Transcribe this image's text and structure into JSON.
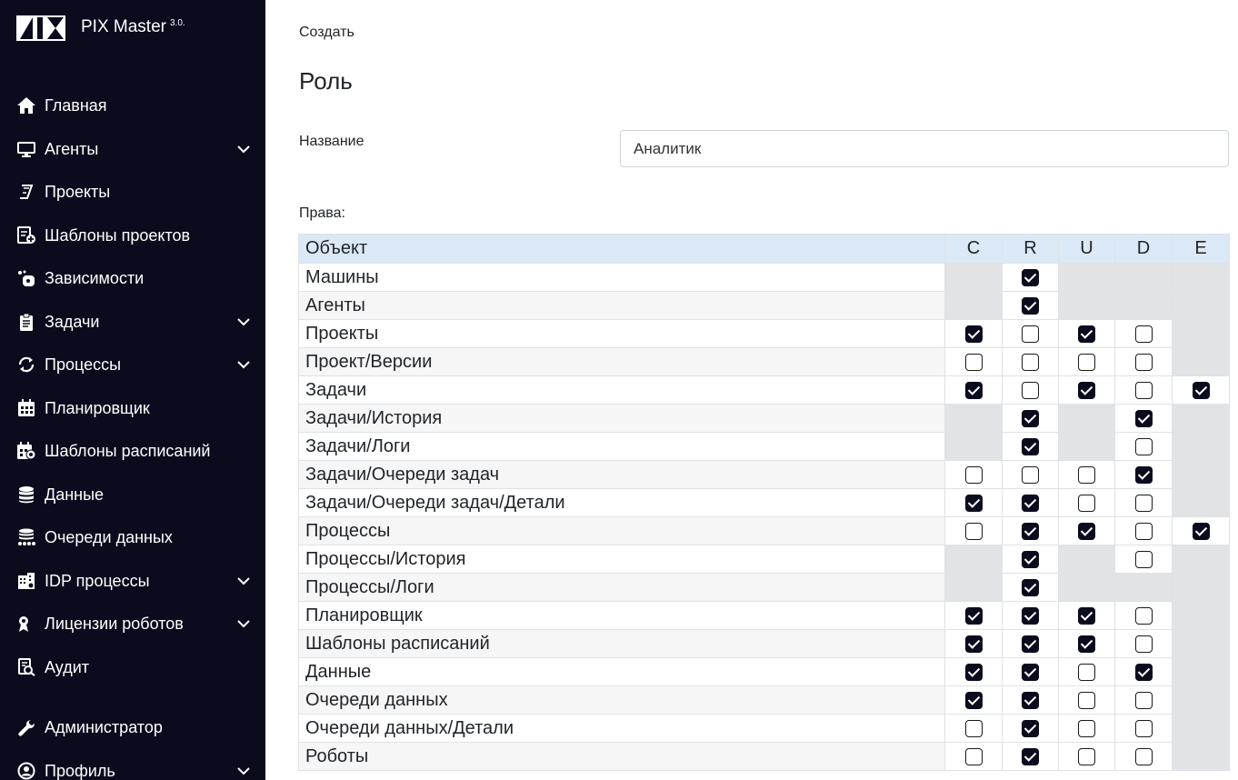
{
  "app": {
    "name": "PIX Master",
    "version": "3.0."
  },
  "sidebar": {
    "items": [
      {
        "label": "Главная",
        "icon": "home-icon",
        "chevron": false
      },
      {
        "label": "Агенты",
        "icon": "monitor-icon",
        "chevron": true
      },
      {
        "label": "Проекты",
        "icon": "projects-icon",
        "chevron": false
      },
      {
        "label": "Шаблоны проектов",
        "icon": "project-templates-icon",
        "chevron": false
      },
      {
        "label": "Зависимости",
        "icon": "dependencies-icon",
        "chevron": false
      },
      {
        "label": "Задачи",
        "icon": "clipboard-icon",
        "chevron": true
      },
      {
        "label": "Процессы",
        "icon": "sync-icon",
        "chevron": true
      },
      {
        "label": "Планировщик",
        "icon": "calendar-icon",
        "chevron": false
      },
      {
        "label": "Шаблоны расписаний",
        "icon": "calendar-settings-icon",
        "chevron": false
      },
      {
        "label": "Данные",
        "icon": "database-icon",
        "chevron": false
      },
      {
        "label": "Очереди данных",
        "icon": "database-queue-icon",
        "chevron": false
      },
      {
        "label": "IDP процессы",
        "icon": "idp-icon",
        "chevron": true
      },
      {
        "label": "Лицензии роботов",
        "icon": "robot-license-icon",
        "chevron": true
      },
      {
        "label": "Аудит",
        "icon": "audit-icon",
        "chevron": false
      },
      {
        "label": "Администратор",
        "icon": "wrench-icon",
        "chevron": false
      },
      {
        "label": "Профиль",
        "icon": "user-circle-icon",
        "chevron": true
      }
    ]
  },
  "main": {
    "breadcrumb": "Создать",
    "title": "Роль",
    "name_label": "Название",
    "name_value": "Аналитик",
    "rights_label": "Права:"
  },
  "permissions": {
    "columns": [
      "Объект",
      "C",
      "R",
      "U",
      "D",
      "E"
    ],
    "legend": {
      "1": "checked",
      "0": "unchecked",
      "null": "not applicable"
    },
    "rows": [
      {
        "object": "Машины",
        "values": [
          null,
          1,
          null,
          null,
          null
        ]
      },
      {
        "object": "Агенты",
        "values": [
          null,
          1,
          null,
          null,
          null
        ]
      },
      {
        "object": "Проекты",
        "values": [
          1,
          0,
          1,
          0,
          null
        ]
      },
      {
        "object": "Проект/Версии",
        "values": [
          0,
          0,
          0,
          0,
          null
        ]
      },
      {
        "object": "Задачи",
        "values": [
          1,
          0,
          1,
          0,
          1
        ]
      },
      {
        "object": "Задачи/История",
        "values": [
          null,
          1,
          null,
          1,
          null
        ]
      },
      {
        "object": "Задачи/Логи",
        "values": [
          null,
          1,
          null,
          0,
          null
        ]
      },
      {
        "object": "Задачи/Очереди задач",
        "values": [
          0,
          0,
          0,
          1,
          null
        ]
      },
      {
        "object": "Задачи/Очереди задач/Детали",
        "values": [
          1,
          1,
          0,
          0,
          null
        ]
      },
      {
        "object": "Процессы",
        "values": [
          0,
          1,
          1,
          0,
          1
        ]
      },
      {
        "object": "Процессы/История",
        "values": [
          null,
          1,
          null,
          0,
          null
        ]
      },
      {
        "object": "Процессы/Логи",
        "values": [
          null,
          1,
          null,
          null,
          null
        ]
      },
      {
        "object": "Планировщик",
        "values": [
          1,
          1,
          1,
          0,
          null
        ]
      },
      {
        "object": "Шаблоны расписаний",
        "values": [
          1,
          1,
          1,
          0,
          null
        ]
      },
      {
        "object": "Данные",
        "values": [
          1,
          1,
          0,
          1,
          null
        ]
      },
      {
        "object": "Очереди данных",
        "values": [
          1,
          1,
          0,
          0,
          null
        ]
      },
      {
        "object": "Очереди данных/Детали",
        "values": [
          0,
          1,
          0,
          0,
          null
        ]
      },
      {
        "object": "Роботы",
        "values": [
          0,
          1,
          0,
          0,
          null
        ]
      }
    ]
  },
  "colors": {
    "sidebar_bg": "#0b0b1e",
    "table_header_bg": "#dbe9f6",
    "na_cell_bg": "#e2e3e5",
    "checkbox_checked": "#0b0b1e"
  }
}
